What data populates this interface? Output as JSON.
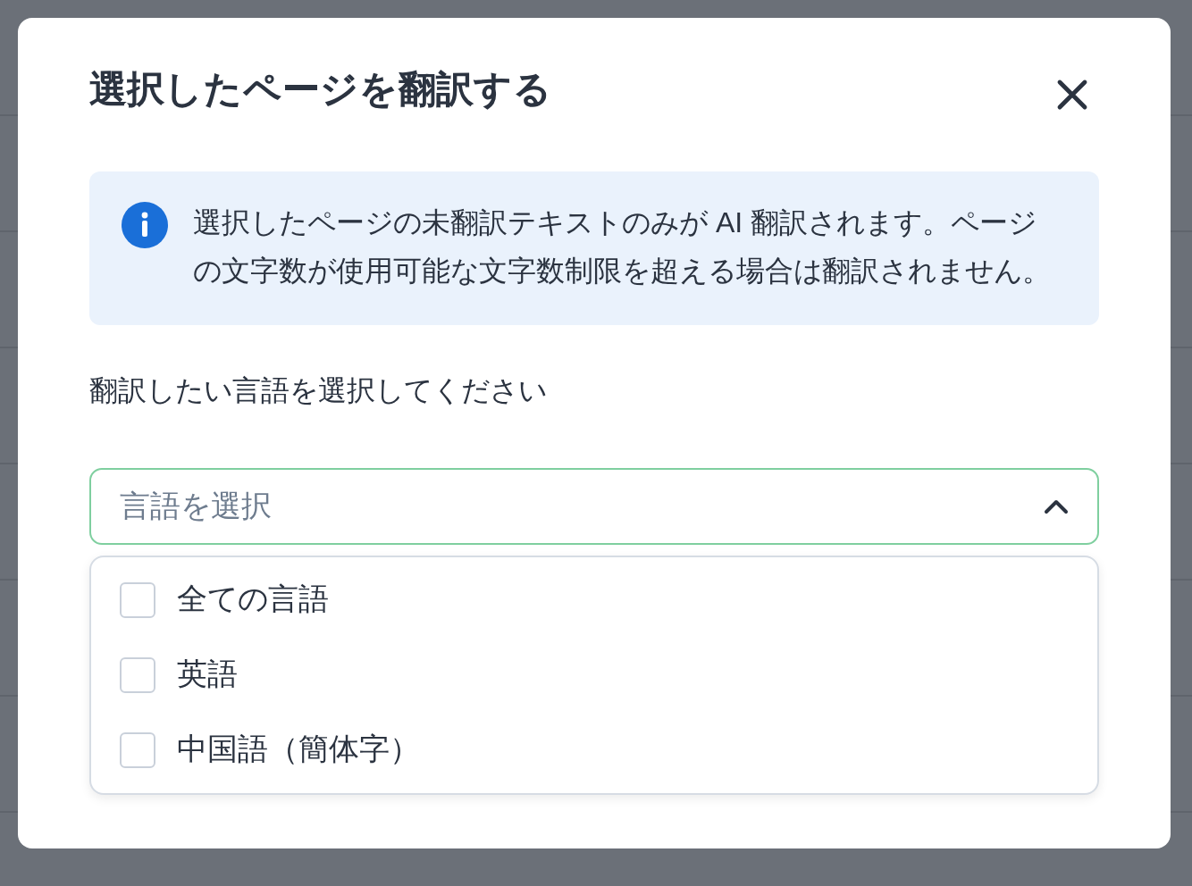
{
  "dialog": {
    "title": "選択したページを翻訳する",
    "notice": "選択したページの未翻訳テキストのみが AI 翻訳されます。ページの文字数が使用可能な文字数制限を超える場合は翻訳されません。",
    "prompt": "翻訳したい言語を選択してください",
    "language_select": {
      "placeholder": "言語を選択",
      "expanded": true,
      "options": [
        {
          "label": "全ての言語",
          "checked": false
        },
        {
          "label": "英語",
          "checked": false
        },
        {
          "label": "中国語（簡体字）",
          "checked": false
        }
      ]
    }
  }
}
